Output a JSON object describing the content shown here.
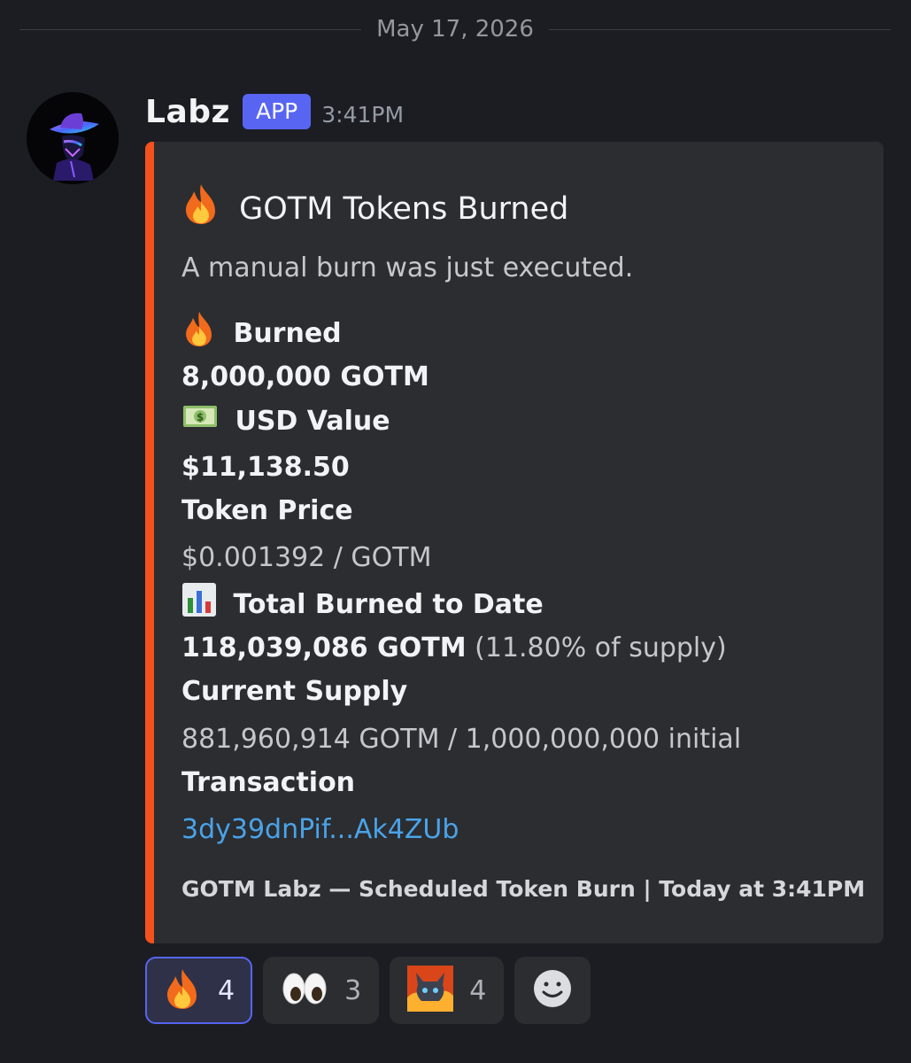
{
  "date_divider": "May 17, 2026",
  "message": {
    "username": "Labz",
    "badge": "APP",
    "timestamp": "3:41PM"
  },
  "embed": {
    "accent_color": "#f4521c",
    "title_emoji": "fire-icon",
    "title": "GOTM Tokens Burned",
    "description": "A manual burn was just executed.",
    "fields": [
      {
        "icon": "fire-icon",
        "name": "Burned",
        "value": "8,000,000 GOTM",
        "value_bold": true
      },
      {
        "icon": "money-icon",
        "name": "USD Value",
        "value": "$11,138.50",
        "value_bold": true
      },
      {
        "name": "Token Price",
        "value": "$0.001392 / GOTM"
      },
      {
        "icon": "bar-chart-icon",
        "name": "Total Burned to Date",
        "value_bold_part": "118,039,086 GOTM",
        "value_rest": "(11.80% of supply)"
      },
      {
        "name": "Current Supply",
        "value": "881,960,914 GOTM / 1,000,000,000 initial"
      },
      {
        "name": "Transaction",
        "value": "3dy39dnPif...Ak4ZUb",
        "is_link": true
      }
    ],
    "footer": "GOTM Labz — Scheduled Token Burn | Today at 3:41PM"
  },
  "reactions": [
    {
      "icon": "fire-icon",
      "count": "4",
      "active": true
    },
    {
      "icon": "eyes-icon",
      "count": "3",
      "active": false
    },
    {
      "icon": "custom-demon-icon",
      "count": "4",
      "active": false
    }
  ],
  "colors": {
    "background": "#1c1d22",
    "embed_bg": "#2b2d31",
    "badge": "#5865f2",
    "link": "#4aa3e8"
  }
}
